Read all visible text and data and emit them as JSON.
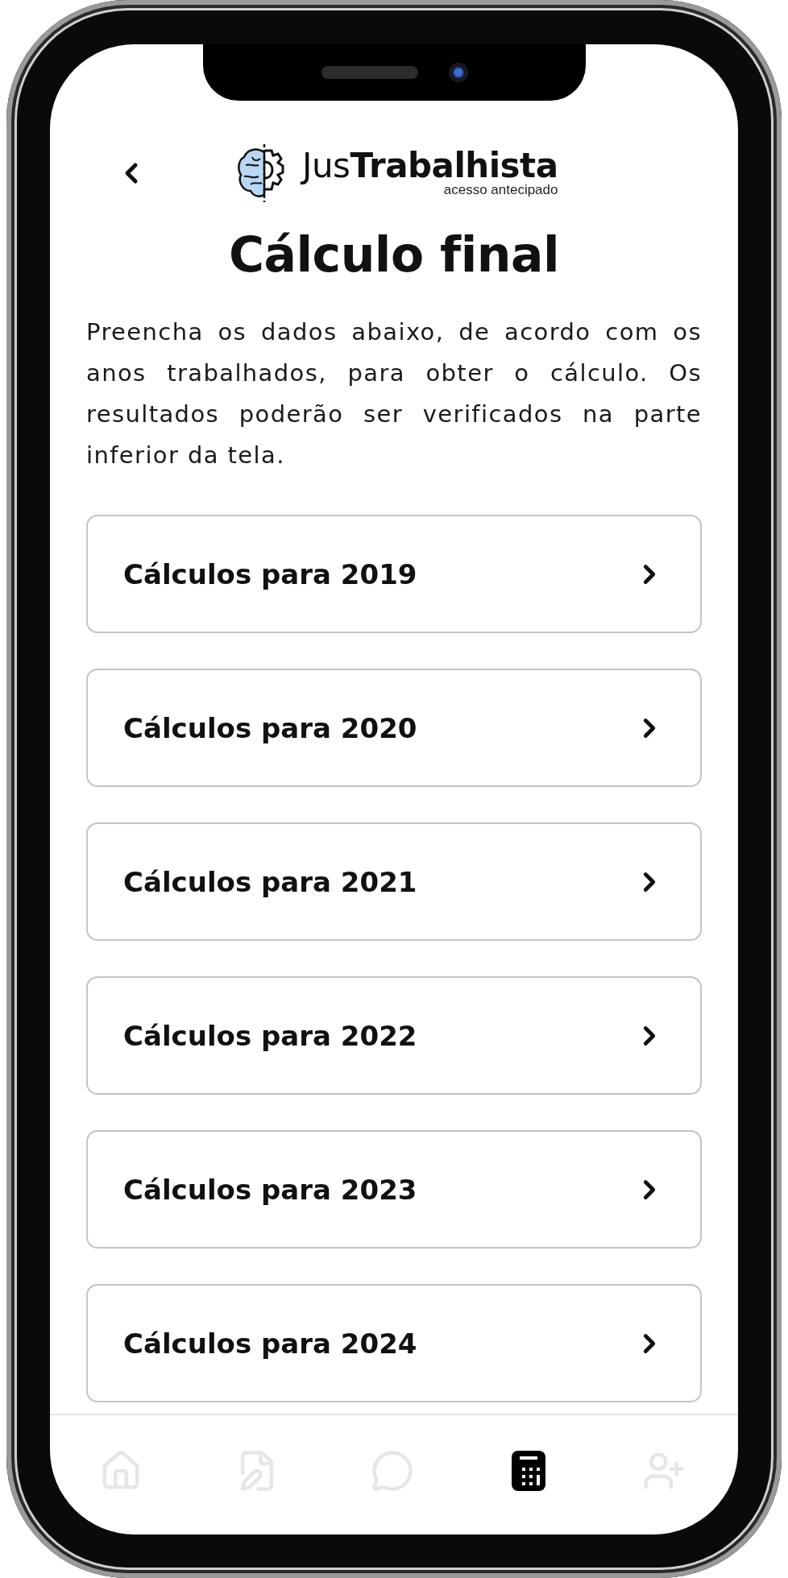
{
  "header": {
    "brand": "Jus**Trabalhista**",
    "tagline": "acesso antecipado"
  },
  "title": "Cálculo final",
  "intro": "Preencha os dados abaixo, de acordo com os anos trabalhados, para obter o cálculo. Os resultados poderão ser verificados na parte inferior da tela.",
  "items": [
    {
      "label": "Cálculos para 2019"
    },
    {
      "label": "Cálculos para 2020"
    },
    {
      "label": "Cálculos para 2021"
    },
    {
      "label": "Cálculos para 2022"
    },
    {
      "label": "Cálculos para 2023"
    },
    {
      "label": "Cálculos para 2024"
    }
  ],
  "nav": {
    "items": [
      {
        "kind": "home",
        "selected": false
      },
      {
        "kind": "document",
        "selected": false
      },
      {
        "kind": "chat",
        "selected": false
      },
      {
        "kind": "calculator",
        "selected": true
      },
      {
        "kind": "user-add",
        "selected": false
      }
    ]
  }
}
